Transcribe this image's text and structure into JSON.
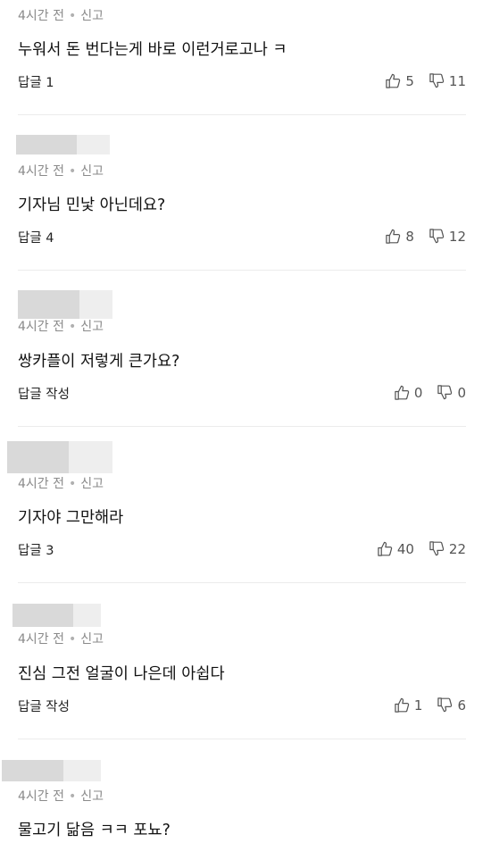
{
  "ui": {
    "separator": "•",
    "report_label": "신고"
  },
  "comments": [
    {
      "time": "4시간 전",
      "text": "누워서 돈 번다는게 바로 이런거로고나 ㅋ",
      "reply": "답글 1",
      "likes": "5",
      "dislikes": "11"
    },
    {
      "time": "4시간 전",
      "text": "기자님 민낯 아닌데요?",
      "reply": "답글 4",
      "likes": "8",
      "dislikes": "12"
    },
    {
      "time": "4시간 전",
      "text": "쌍카플이 저렇게 큰가요?",
      "reply": "답글 작성",
      "likes": "0",
      "dislikes": "0"
    },
    {
      "time": "4시간 전",
      "text": "기자야 그만해라",
      "reply": "답글 3",
      "likes": "40",
      "dislikes": "22"
    },
    {
      "time": "4시간 전",
      "text": "진심 그전 얼굴이 나은데 아쉽다",
      "reply": "답글 작성",
      "likes": "1",
      "dislikes": "6"
    },
    {
      "time": "4시간 전",
      "text": "물고기 닮음 ㅋㅋ 포뇨?"
    }
  ]
}
